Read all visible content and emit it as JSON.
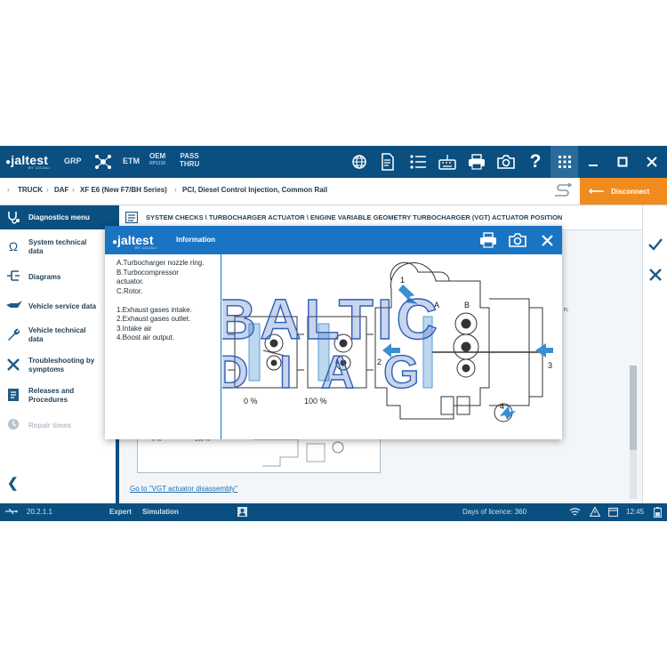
{
  "toolbar": {
    "logo": "jaltest",
    "logo_sub": "BY COJALI",
    "grp": "GRP",
    "etm": "ETM",
    "oem": "OEM",
    "oem_sub": "RP1210",
    "pass": "PASS",
    "pass_sub": "THRU",
    "icons": [
      "globe-icon",
      "document-icon",
      "list-icon",
      "keyboard-icon",
      "printer-icon",
      "camera-icon",
      "help-icon",
      "apps-grid-icon"
    ],
    "window_buttons": [
      "minimize",
      "maximize",
      "close"
    ]
  },
  "breadcrumb": {
    "items": [
      "TRUCK",
      "DAF",
      "XF E6 (New F7/BH Series)",
      "PCI, Diesel Control Injection, Common Rail"
    ],
    "disconnect_label": "Disconnect"
  },
  "sidebar": {
    "header": "Diagnostics menu",
    "items": [
      {
        "label": "System technical data",
        "icon": "omega-icon",
        "enabled": true
      },
      {
        "label": "Diagrams",
        "icon": "diagram-icon",
        "enabled": true
      },
      {
        "label": "Vehicle service data",
        "icon": "oil-can-icon",
        "enabled": true
      },
      {
        "label": "Vehicle technical data",
        "icon": "wrench-icon",
        "enabled": true
      },
      {
        "label": "Troubleshooting by symptoms",
        "icon": "tools-icon",
        "enabled": true
      },
      {
        "label": "Releases and Procedures",
        "icon": "procedures-icon",
        "enabled": true
      },
      {
        "label": "Repair times",
        "icon": "clock-icon",
        "enabled": false
      }
    ]
  },
  "main": {
    "breadcrumb_title": "SYSTEM CHECKS \\ TURBOCHARGER ACTUATOR \\ ENGINE VARIABLE GEOMETRY TURBOCHARGER (VGT) ACTUATOR POSITION",
    "background_fragment": "n.",
    "background_labels": [
      "0 %",
      "100 %"
    ],
    "link": "Go to \"VGT actuator disassembly\""
  },
  "statusbar": {
    "version": "20.2.1.1",
    "mode": "Expert",
    "simulation": "Simulation",
    "licence": "Days of licence: 360",
    "time": "12:45"
  },
  "modal": {
    "logo": "jaltest",
    "logo_sub": "BY COJALI",
    "title": "Information",
    "lines": [
      "A.Turbocharger nozzle ring.",
      "B.Turbocompressor",
      "actuator.",
      "C.Rotor.",
      "",
      "1.Exhaust gases intake.",
      "2.Exhaust gases outlet.",
      "3.Intake air",
      "4.Boost air output."
    ],
    "figure": {
      "pct0": "0 %",
      "pct100": "100 %",
      "labelA": "A",
      "labelB": "B",
      "n1": "1",
      "n2": "2",
      "n3": "3",
      "n4": "4",
      "watermark": [
        "BALTIC",
        "D I A G"
      ],
      "watermark_color": "#2f5fb5"
    }
  }
}
